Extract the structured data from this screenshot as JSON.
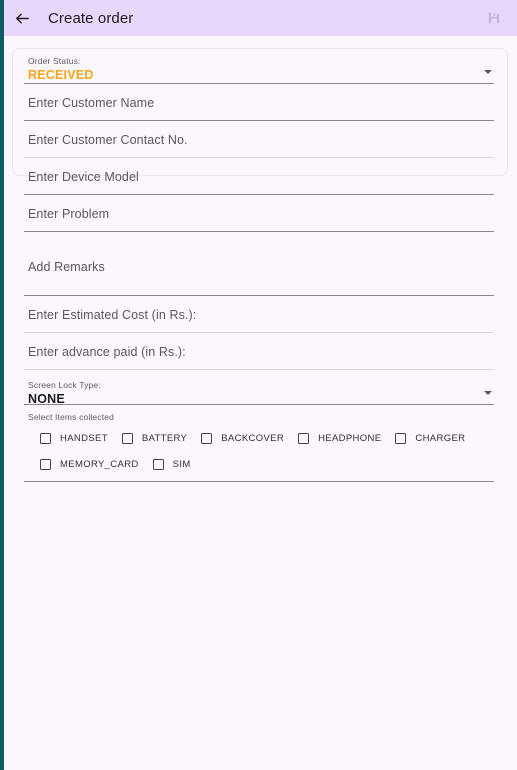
{
  "app_bar": {
    "back_icon": "arrow-left-icon",
    "title": "Create order",
    "save_icon": "save-floppy-icon"
  },
  "colors": {
    "app_bar_bg": "#e7d8fb",
    "page_bg": "#fcf7fc",
    "accent_orange": "#f9a41c",
    "edge_strip": "#0d5c66",
    "underline": "#8f8592",
    "text_primary": "#1d1b20",
    "text_secondary": "#5d555f",
    "caption": "#615a63"
  },
  "form": {
    "order_status": {
      "caption": "Order Status:",
      "value": "RECEIVED",
      "dropdown_icon": "chevron-down-icon"
    },
    "customer_name": {
      "placeholder": "Enter Customer Name",
      "value": ""
    },
    "customer_contact": {
      "placeholder": "Enter Customer Contact No.",
      "value": ""
    },
    "device_model": {
      "placeholder": "Enter Device Model",
      "value": ""
    },
    "problem": {
      "placeholder": "Enter Problem",
      "value": ""
    },
    "remarks": {
      "placeholder": "Add Remarks",
      "value": ""
    },
    "estimated_cost": {
      "placeholder": "Enter Estimated Cost (in Rs.):",
      "value": ""
    },
    "advance_paid": {
      "placeholder": "Enter advance paid (in Rs.):",
      "value": ""
    },
    "screen_lock": {
      "caption": "Screen Lock Type:",
      "value": "NONE",
      "dropdown_icon": "chevron-down-icon"
    },
    "items_collected": {
      "caption": "Select Items collected",
      "rows": [
        [
          {
            "label": "HANDSET",
            "checked": false
          },
          {
            "label": "BATTERY",
            "checked": false
          },
          {
            "label": "BACKCOVER",
            "checked": false
          },
          {
            "label": "HEADPHONE",
            "checked": false
          },
          {
            "label": "CHARGER",
            "checked": false
          }
        ],
        [
          {
            "label": "MEMORY_CARD",
            "checked": false
          },
          {
            "label": "SIM",
            "checked": false
          }
        ]
      ]
    }
  }
}
